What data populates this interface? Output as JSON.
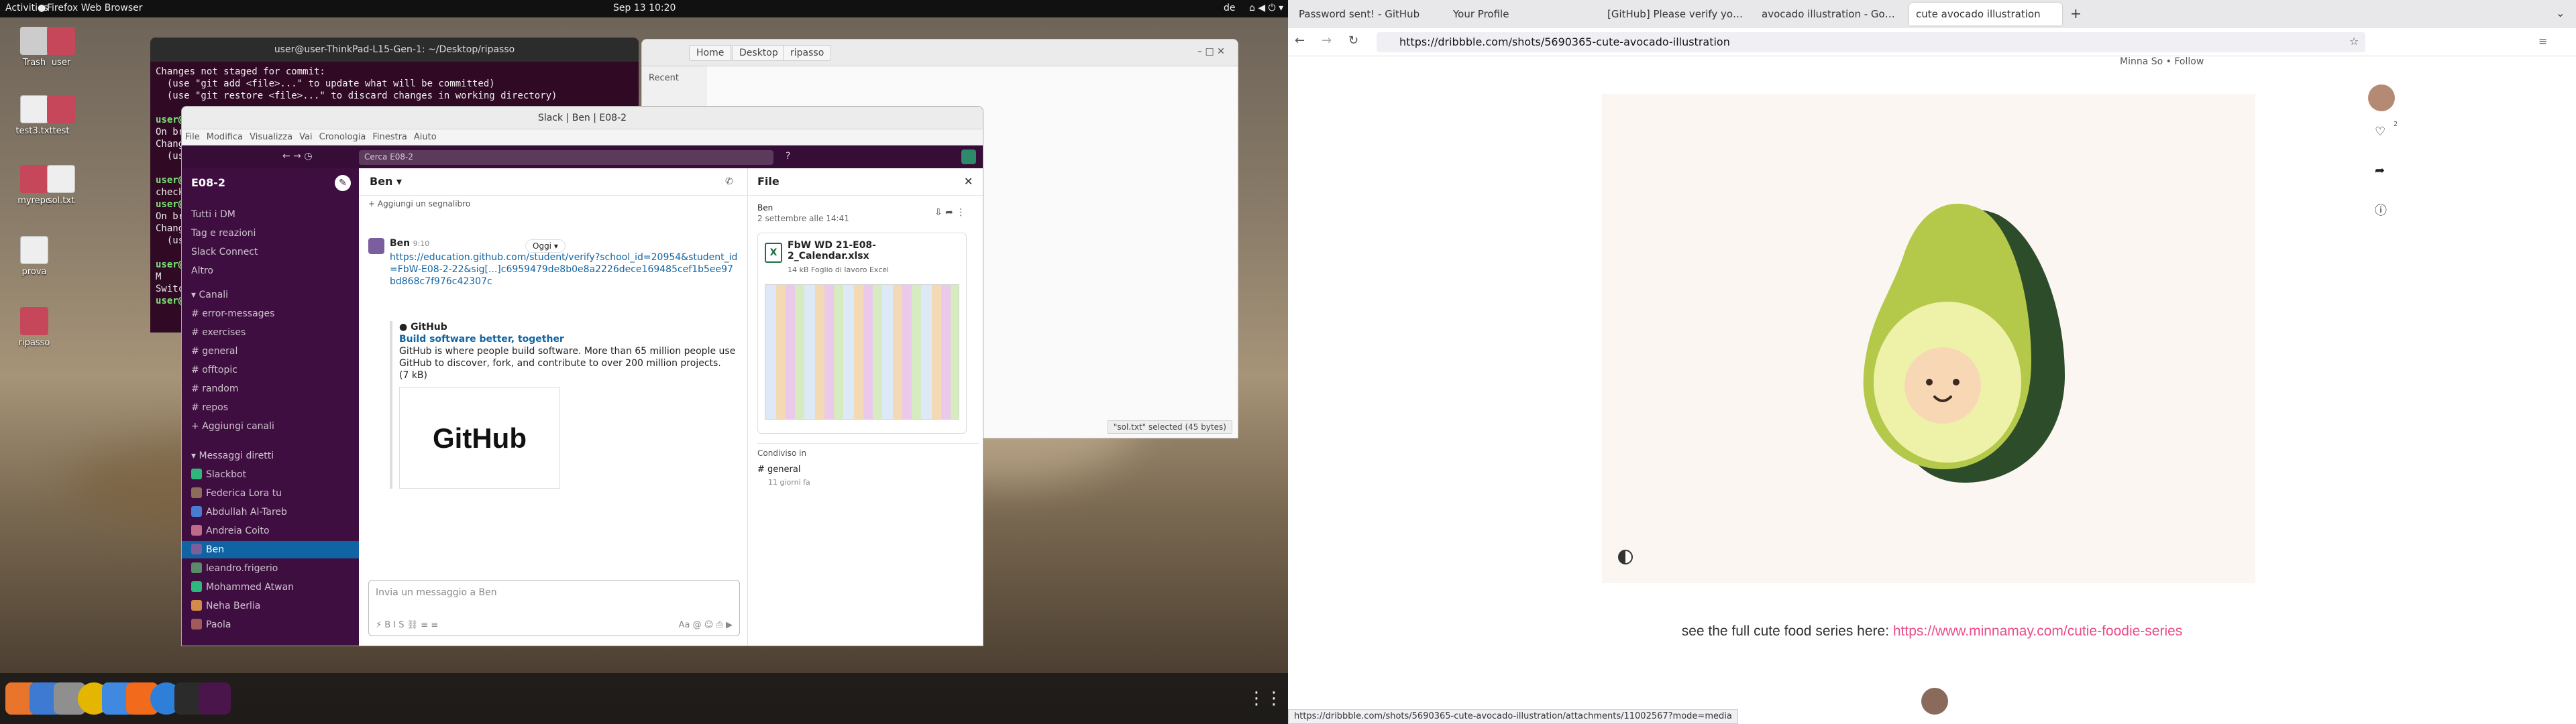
{
  "topbar": {
    "activities": "Activities",
    "app": "Firefox Web Browser",
    "clock": "Sep 13  10:20",
    "lang": "de"
  },
  "desktop": {
    "icons": [
      {
        "label": "Trash"
      },
      {
        "label": "user"
      },
      {
        "label": "test3.txt"
      },
      {
        "label": "test"
      },
      {
        "label": "myrepo"
      },
      {
        "label": "sol.txt"
      },
      {
        "label": "prova"
      },
      {
        "label": "ripasso"
      }
    ]
  },
  "terminal": {
    "title": "user@user-ThinkPad-L15-Gen-1: ~/Desktop/ripasso",
    "lines": [
      "Changes not staged for commit:",
      "  (use \"git add <file>...\" to update what will be committed)",
      "  (use \"git restore <file>...\" to discard changes in working directory)",
      "",
      "user@",
      "On br",
      "Chang",
      "  (us",
      "",
      "user@",
      "check",
      "user@",
      "On br",
      "Chang",
      "  (us",
      "",
      "user@",
      "M",
      "Switc",
      "user@"
    ]
  },
  "files": {
    "breadcrumb": [
      "Home",
      "Desktop",
      "ripasso"
    ],
    "sidebar": "Recent",
    "status": "\"sol.txt\" selected  (45 bytes)"
  },
  "slack": {
    "title": "Slack | Ben | E08-2",
    "menu": [
      "File",
      "Modifica",
      "Visualizza",
      "Vai",
      "Cronologia",
      "Finestra",
      "Aiuto"
    ],
    "search_placeholder": "Cerca E08-2",
    "workspace": "E08-2",
    "nav": [
      "Tutti i DM",
      "Tag e reazioni",
      "Slack Connect",
      "Altro"
    ],
    "channels_header": "Canali",
    "channels": [
      "error-messages",
      "exercises",
      "general",
      "offtopic",
      "random",
      "repos"
    ],
    "add_channels": "Aggiungi canali",
    "dm_header": "Messaggi diretti",
    "dms": [
      "Slackbot",
      "Federica Lora  tu",
      "Abdullah Al-Tareb",
      "Andreia Coito",
      "Ben",
      "leandro.frigerio",
      "Mohammed Atwan",
      "Neha Berlia",
      "Paola"
    ],
    "chat_title": "Ben",
    "bookmark": "Aggiungi un segnalibro",
    "date_pill": "Oggi",
    "msg_author": "Ben",
    "msg_time": "9:10",
    "msg_link": "https://education.github.com/student/verify?school_id=20954&student_id=FbW-E08-2-22&sig[...]c6959479de8b0e8a2226dece169485cef1b5ee97bd868c7f976c42307c",
    "preview_site": "GitHub",
    "preview_title": "Build software better, together",
    "preview_desc": "GitHub is where people build software. More than 65 million people use GitHub to discover, fork, and contribute to over 200 million projects.",
    "preview_size": "(7 kB)",
    "preview_logo": "GitHub",
    "input_placeholder": "Invia un messaggio a Ben",
    "panel_title": "File",
    "panel_author": "Ben",
    "panel_date": "2 settembre alle 14:41",
    "file_name": "FbW WD 21-E08-2_Calendar.xlsx",
    "file_meta": "14 kB Foglio di lavoro Excel",
    "shared_in": "Condiviso in",
    "shared_channel": "general",
    "shared_ago": "11 giorni fa"
  },
  "browser": {
    "tabs": [
      "Password sent! - GitHub",
      "Your Profile",
      "[GitHub] Please verify yo…",
      "avocado illustration - Go…",
      "cute avocado illustration"
    ],
    "url": "https://dribbble.com/shots/5690365-cute-avocado-illustration",
    "author": "Minna So  •  Follow",
    "caption_text": "see the full cute food series here: ",
    "caption_link": "https://www.minnamay.com/cutie-foodie-series",
    "status_url": "https://dribbble.com/shots/5690365-cute-avocado-illustration/attachments/11002567?mode=media",
    "likes": "2"
  }
}
